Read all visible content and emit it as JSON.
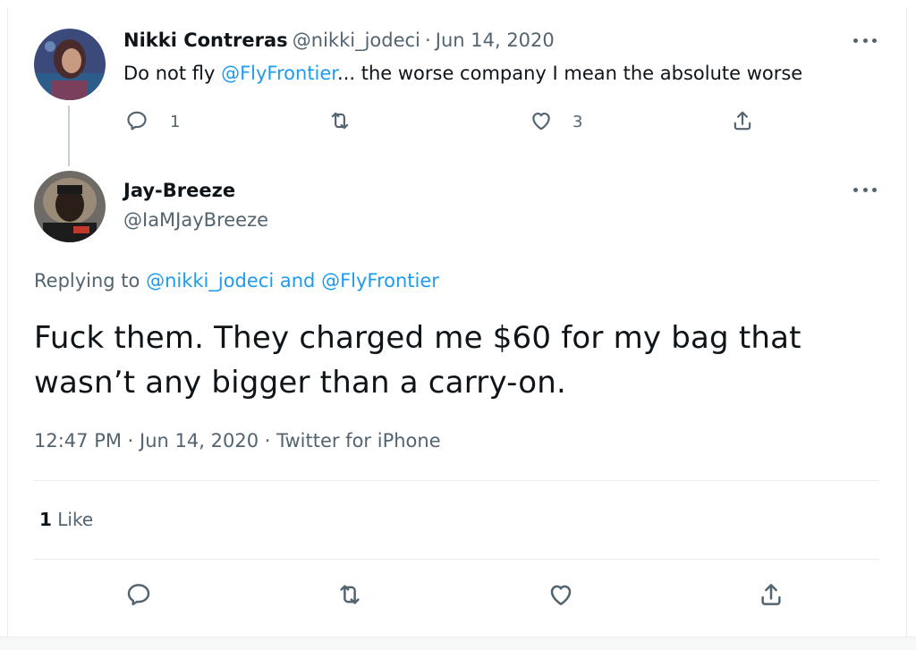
{
  "parent_tweet": {
    "display_name": "Nikki Contreras",
    "handle": "@nikki_jodeci",
    "separator": "·",
    "date": "Jun 14, 2020",
    "text_before": "Do not fly ",
    "mention": "@FlyFrontier",
    "text_after": "... the worse company I mean the absolute worse",
    "reply_count": "1",
    "like_count": "3",
    "icons": {
      "reply": "reply-icon",
      "retweet": "retweet-icon",
      "like": "heart-icon",
      "share": "share-icon",
      "more": "more-icon"
    }
  },
  "main_tweet": {
    "display_name": "Jay-Breeze",
    "handle": "@IaMJayBreeze",
    "replying_label": "Replying to ",
    "replying_user1": "@nikki_jodeci",
    "replying_and": " and ",
    "replying_user2": "@FlyFrontier",
    "text_line1": "Fuck them. They charged me $60 for my bag that",
    "text_line2": "wasn’t any bigger than a carry-on.",
    "time": "12:47 PM",
    "separator": "·",
    "date": "Jun 14, 2020",
    "source": "Twitter for iPhone",
    "like_count": "1",
    "like_label": " Like"
  },
  "colors": {
    "accent": "#1d9bf0",
    "text": "#0f1419",
    "secondary": "#536471",
    "border": "#e6ecf0"
  }
}
